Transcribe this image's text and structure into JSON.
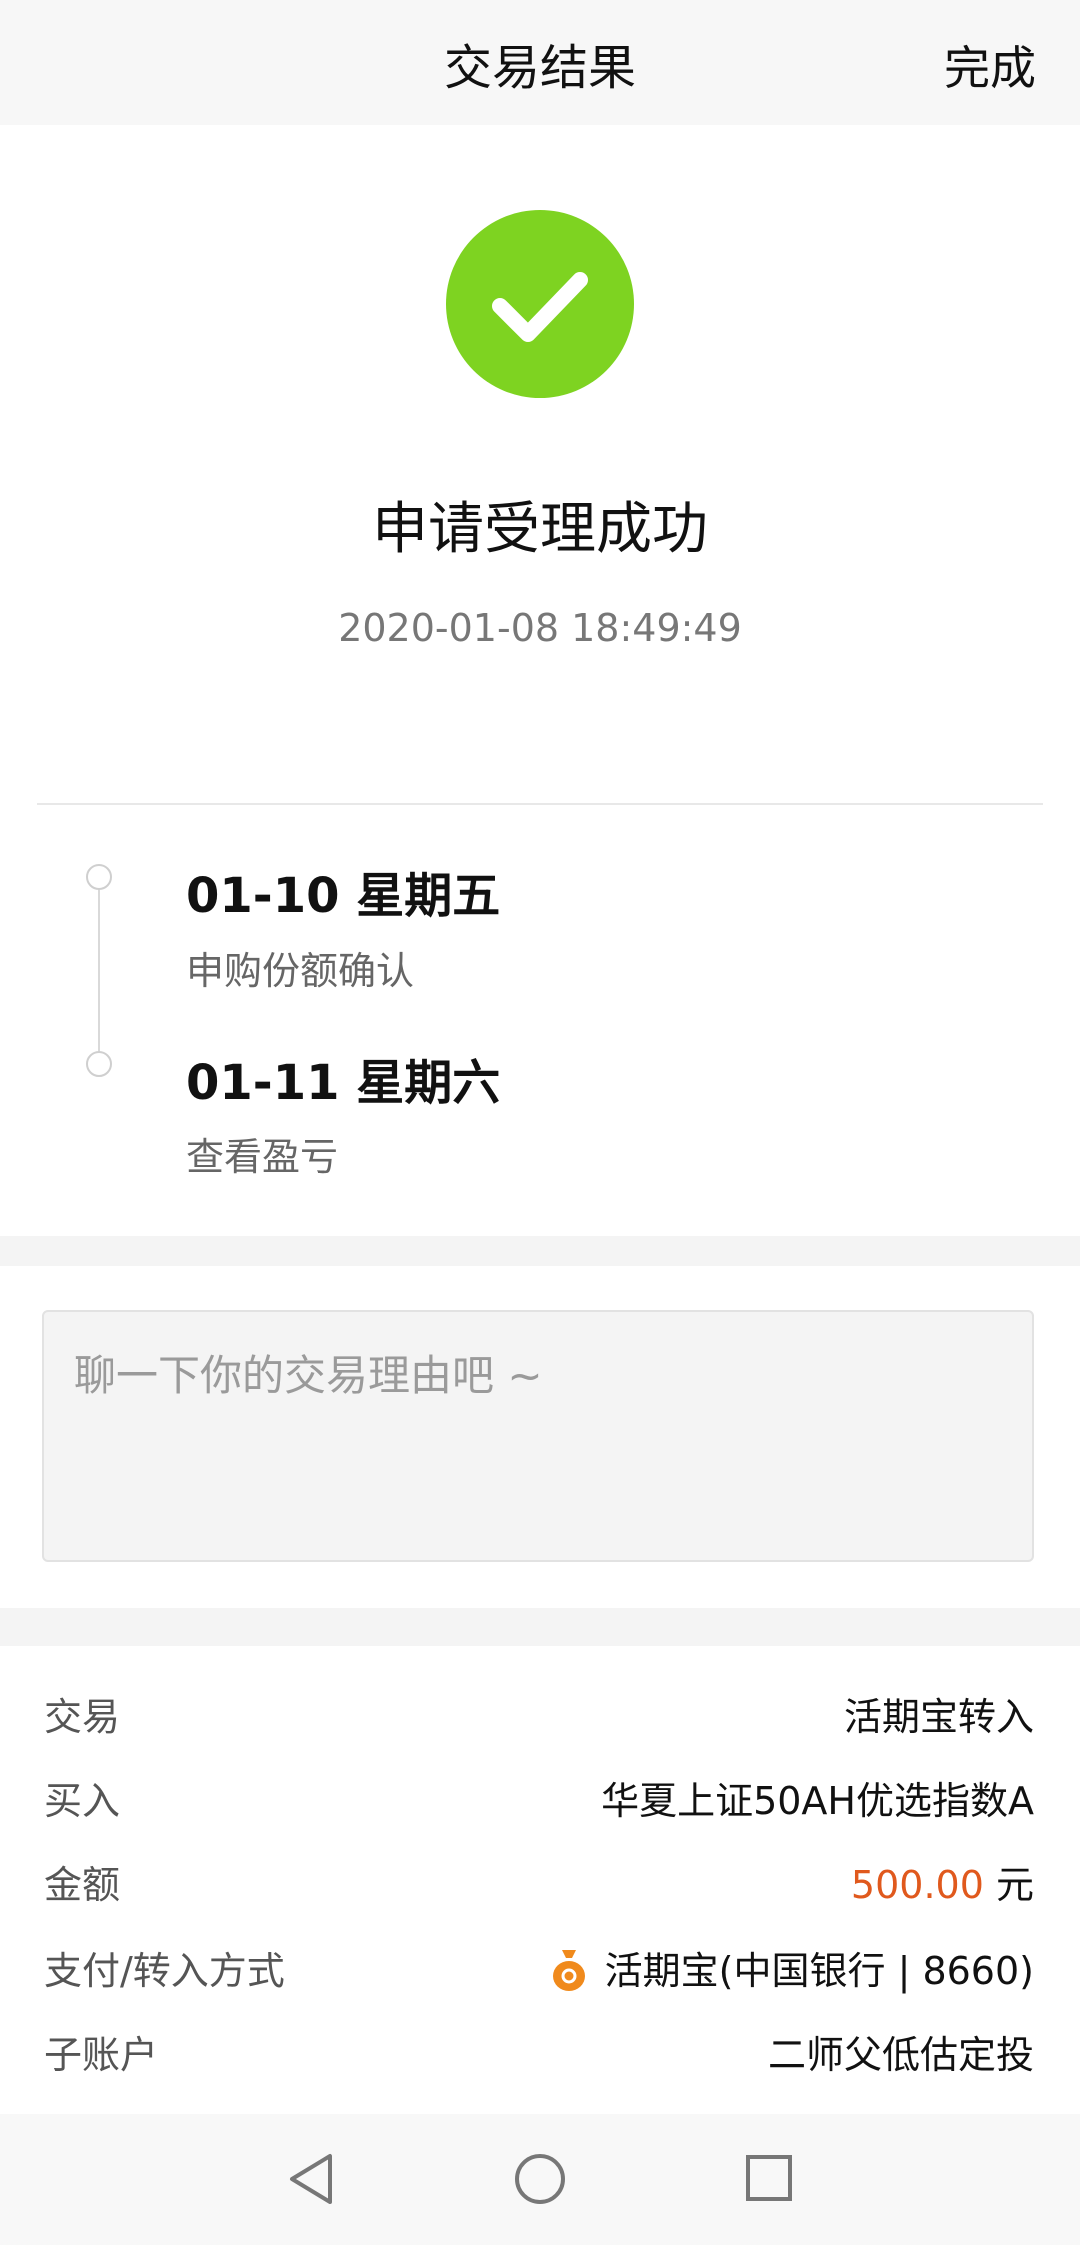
{
  "header": {
    "title": "交易结果",
    "done_label": "完成"
  },
  "result": {
    "icon": "check-icon",
    "status": "申请受理成功",
    "time": "2020-01-08 18:49:49",
    "accent_color": "#7ed321"
  },
  "timeline": [
    {
      "date": "01-10  星期五",
      "desc": "申购份额确认"
    },
    {
      "date": "01-11  星期六",
      "desc": "查看盈亏"
    }
  ],
  "reason": {
    "placeholder": "聊一下你的交易理由吧 ~"
  },
  "details": {
    "trade_label": "交易",
    "trade_value": "活期宝转入",
    "buy_label": "买入",
    "buy_value": "华夏上证50AH优选指数A",
    "amount_label": "金额",
    "amount_value": "500.00",
    "amount_unit": "元",
    "amount_color": "#e0591d",
    "pay_label": "支付/转入方式",
    "pay_icon": "money-bag-icon",
    "pay_value": "活期宝(中国银行 | 8660)",
    "sub_label": "子账户",
    "sub_value": "二师父低估定投"
  },
  "navbar": {
    "back_icon": "back-triangle-icon",
    "home_icon": "home-circle-icon",
    "recent_icon": "recent-square-icon"
  }
}
